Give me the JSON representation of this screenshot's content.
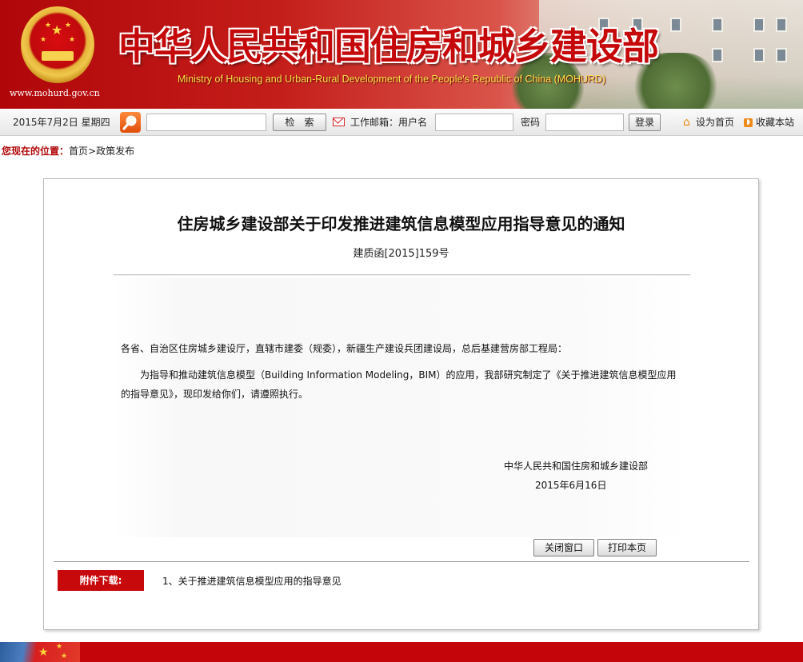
{
  "header": {
    "title": "中华人民共和国住房和城乡建设部",
    "subtitle": "Ministry of Housing and Urban-Rural Development of the People's Republic of China (MOHURD)",
    "url": "www.mohurd.gov.cn",
    "emblem_icon": "national-emblem-icon"
  },
  "toolbar": {
    "date": "2015年7月2日 星期四",
    "search_input_value": "",
    "search_button": "检　索",
    "mail_label": "工作邮箱：用户名",
    "username_value": "",
    "password_label": "密码",
    "password_value": "",
    "login_button": "登录",
    "set_homepage": "设为首页",
    "bookmark": "收藏本站"
  },
  "breadcrumb": {
    "lead": "您现在的位置：",
    "home": "首页",
    "separator": ">",
    "current": "政策发布"
  },
  "article": {
    "title": "住房城乡建设部关于印发推进建筑信息模型应用指导意见的通知",
    "doc_number": "建质函[2015]159号",
    "salutation": "各省、自治区住房城乡建设厅，直辖市建委（规委），新疆生产建设兵团建设局，总后基建营房部工程局：",
    "body": "为指导和推动建筑信息模型（Building Information Modeling，BIM）的应用，我部研究制定了《关于推进建筑信息模型应用的指导意见》，现印发给你们，请遵照执行。",
    "signature_org": "中华人民共和国住房和城乡建设部",
    "signature_date": "2015年6月16日"
  },
  "actions": {
    "close_window": "关闭窗口",
    "print_page": "打印本页"
  },
  "attachments": {
    "label": "附件下载:",
    "items": [
      "1、关于推进建筑信息模型应用的指导意见"
    ]
  },
  "colors": {
    "brand_red": "#c4060a",
    "subtitle_yellow": "#f7e34a",
    "toolbar_bg": "#ececec"
  }
}
